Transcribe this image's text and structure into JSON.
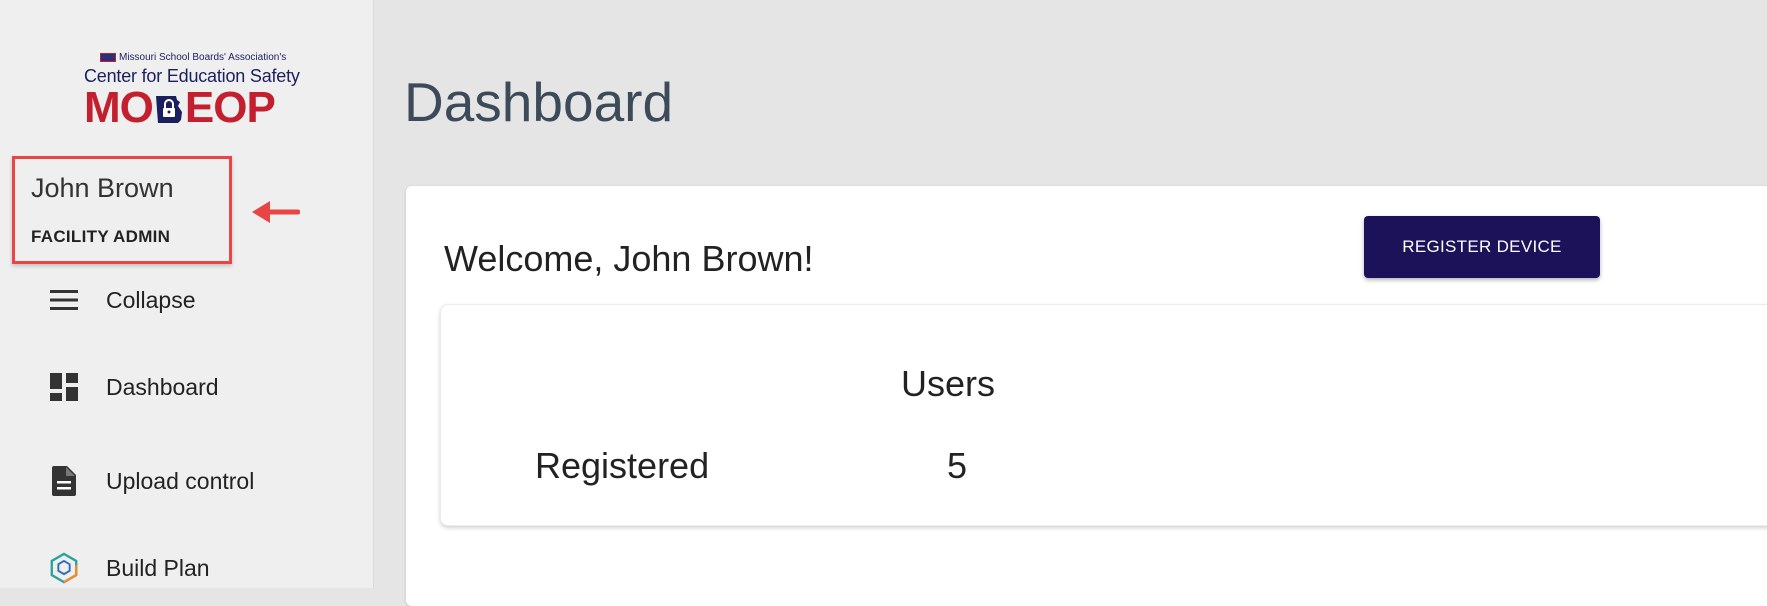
{
  "logo": {
    "association": "Missouri School Boards' Association's",
    "center": "Center for Education Safety",
    "mark_left": "MO",
    "mark_right": "EOP"
  },
  "user": {
    "name": "John Brown",
    "role": "FACILITY ADMIN"
  },
  "nav": [
    {
      "label": "Collapse",
      "icon": "menu-icon"
    },
    {
      "label": "Dashboard",
      "icon": "dashboard-icon"
    },
    {
      "label": "Upload control",
      "icon": "document-icon"
    },
    {
      "label": "Build Plan",
      "icon": "hexagon-icon"
    }
  ],
  "main": {
    "title": "Dashboard",
    "welcome": "Welcome, John Brown!",
    "register_button": "REGISTER DEVICE",
    "stats": {
      "column_header": "Users",
      "row_label": "Registered",
      "row_value": "5"
    }
  },
  "colors": {
    "accent": "#1c1259",
    "highlight": "#e84545",
    "brand_red": "#c31f2e",
    "brand_navy": "#1b1f5e"
  }
}
